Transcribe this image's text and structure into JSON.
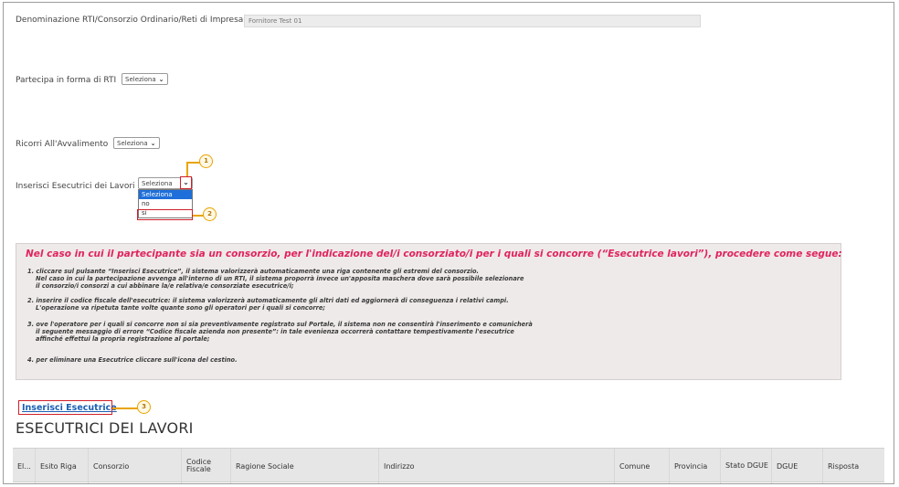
{
  "form": {
    "denominazione_label": "Denominazione RTI/Consorzio Ordinario/Reti di Impresa",
    "denominazione_value": "Fornitore Test 01",
    "partecipa_label": "Partecipa in forma di RTI",
    "partecipa_value": "Seleziona",
    "avvalimento_label": "Ricorri All'Avvalimento",
    "avvalimento_value": "Seleziona",
    "esecutrici_label": "Inserisci Esecutrici dei Lavori",
    "esecutrici_value": "Seleziona",
    "esecutrici_options": [
      "Seleziona",
      "no",
      "si"
    ]
  },
  "callouts": {
    "one": "1",
    "two": "2",
    "three": "3"
  },
  "info": {
    "title": "Nel caso in cui il partecipante sia un consorzio, per l'indicazione del/i consorziato/i per i quali si concorre (“Esecutrice lavori”), procedere come segue:",
    "item1_line1": "1. cliccare sul pulsante “Inserisci Esecutrice”, il sistema valorizzerà automaticamente una riga contenente gli estremi del consorzio.",
    "item1_line2": "Nel caso in cui la partecipazione avvenga all'interno di un RTI, il sistema proporrà invece un'apposita maschera dove sarà possibile selezionare",
    "item1_line3": "il consorzio/i consorzi a cui abbinare la/e relativa/e consorziate esecutrice/i;",
    "item2_line1": "2. inserire il codice fiscale dell'esecutrice: il sistema valorizzerà automaticamente gli altri dati ed aggiornerà di conseguenza i relativi campi.",
    "item2_line2": "L'operazione va ripetuta tante volte quante sono gli operatori per i quali si concorre;",
    "item3_line1": "3. ove l'operatore per i quali si concorre non si sia preventivamente registrato sul Portale, il sistema non ne consentirà l'inserimento e comunicherà",
    "item3_line2": "il seguente messaggio di errore “Codice fiscale azienda non presente”: in tale evenienza occorrerà contattare tempestivamente l'esecutrice",
    "item3_line3": "affinché effettui la propria registrazione al portale;",
    "item4_line1": "4. per eliminare una Esecutrice cliccare sull'icona del cestino."
  },
  "link_label": "Inserisci Esecutrice",
  "section_title": "ESECUTRICI DEI LAVORI",
  "table": {
    "columns": [
      "El...",
      "Esito Riga",
      "Consorzio",
      "Codice Fiscale",
      "Ragione Sociale",
      "Indirizzo",
      "Comune",
      "Provincia",
      "Stato DGUE",
      "DGUE",
      "Risposta"
    ]
  }
}
